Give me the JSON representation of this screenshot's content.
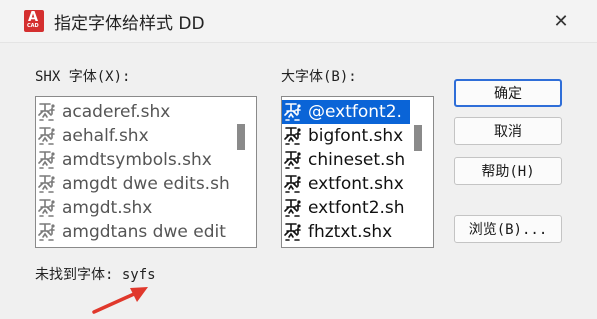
{
  "window": {
    "title": "指定字体给样式 DD",
    "app_icon_text": "A",
    "app_icon_sub": "CAD",
    "close_glyph": "✕"
  },
  "shx_font": {
    "label": "SHX 字体(X):",
    "items": [
      "acaderef.shx",
      "aehalf.shx",
      "amdtsymbols.shx",
      "amgdt dwe edits.sh",
      "amgdt.shx",
      "amgdtans dwe edit"
    ]
  },
  "big_font": {
    "label": "大字体(B):",
    "selected_index": 0,
    "items": [
      "@extfont2.",
      "bigfont.shx",
      "chineset.sh",
      "extfont.shx",
      "extfont2.sh",
      "fhztxt.shx"
    ]
  },
  "buttons": {
    "ok": "确定",
    "cancel": "取消",
    "help": "帮助(H)",
    "browse": "浏览(B)..."
  },
  "missing_font": {
    "label": "未找到字体:",
    "value": "syfs"
  },
  "colors": {
    "selection": "#0a64d7",
    "arrow": "#e0382c",
    "icon_red": "#d42f2f"
  }
}
